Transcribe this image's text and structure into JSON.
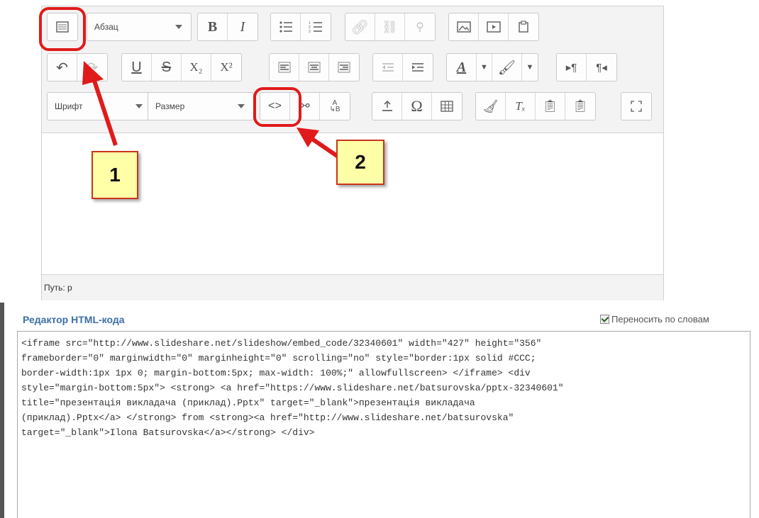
{
  "toolbar": {
    "format_select": "Абзац",
    "font_select": "Шрифт",
    "size_select": "Размер",
    "bold_label": "B",
    "italic_label": "I",
    "underline_label": "U",
    "strike_label": "S",
    "subscript_label": "X₂",
    "superscript_label": "X²",
    "pilcrow_ltr": "▸¶",
    "pilcrow_rtl": "¶◂",
    "omega_label": "Ω",
    "source_label": "<>"
  },
  "statusbar": {
    "path_label": "Путь: p"
  },
  "annotations": {
    "callout_1": "1",
    "callout_2": "2",
    "color": "#e01b1b"
  },
  "source_editor": {
    "title": "Редактор HTML-кода",
    "wrap_label": "Переносить по словам",
    "wrap_checked": true,
    "code": "<iframe src=\"http://www.slideshare.net/slideshow/embed_code/32340601\" width=\"427\" height=\"356\"\nframeborder=\"0\" marginwidth=\"0\" marginheight=\"0\" scrolling=\"no\" style=\"border:1px solid #CCC;\nborder-width:1px 1px 0; margin-bottom:5px; max-width: 100%;\" allowfullscreen> </iframe> <div\nstyle=\"margin-bottom:5px\"> <strong> <a href=\"https://www.slideshare.net/batsurovska/pptx-32340601\"\ntitle=\"презентація викладача (приклад).Pptx\" target=\"_blank\">презентація викладача\n(приклад).Pptx</a> </strong> from <strong><a href=\"http://www.slideshare.net/batsurovska\"\ntarget=\"_blank\">Ilona Batsurovska</a></strong> </div>"
  }
}
